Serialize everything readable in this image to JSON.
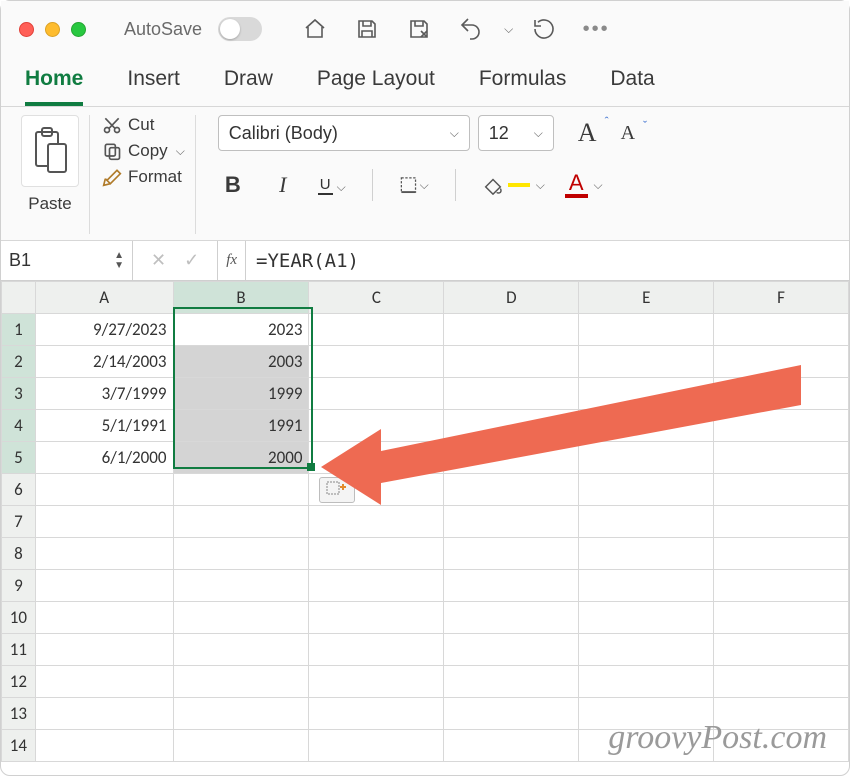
{
  "titlebar": {
    "autosave_label": "AutoSave"
  },
  "tabs": {
    "home": "Home",
    "insert": "Insert",
    "draw": "Draw",
    "page_layout": "Page Layout",
    "formulas": "Formulas",
    "data": "Data"
  },
  "ribbon": {
    "paste": "Paste",
    "cut": "Cut",
    "copy": "Copy",
    "format": "Format",
    "font_name": "Calibri (Body)",
    "font_size": "12",
    "bold": "B",
    "italic": "I",
    "underline": "U",
    "fontcolor_letter": "A"
  },
  "formula_bar": {
    "cell_ref": "B1",
    "fx": "fx",
    "formula": "=YEAR(A1)"
  },
  "headers": {
    "cols": [
      "A",
      "B",
      "C",
      "D",
      "E",
      "F"
    ],
    "selected_col": "B",
    "rows_visible": 14,
    "selected_rows": [
      1,
      2,
      3,
      4,
      5
    ]
  },
  "cells": {
    "A": [
      "9/27/2023",
      "2/14/2003",
      "3/7/1999",
      "5/1/1991",
      "6/1/2000"
    ],
    "B": [
      "2023",
      "2003",
      "1999",
      "1991",
      "2000"
    ]
  },
  "watermark": "groovyPost.com"
}
